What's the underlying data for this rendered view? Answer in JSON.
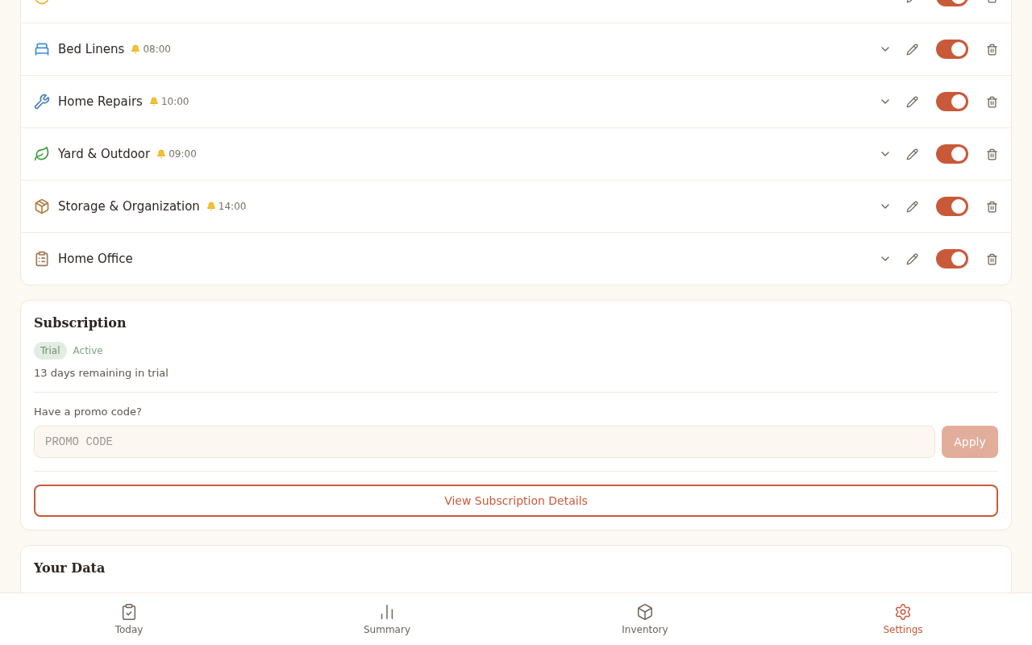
{
  "categories": [
    {
      "enabled": true
    },
    {
      "name": "Bed Linens",
      "reminder": "08:00",
      "enabled": true
    },
    {
      "name": "Home Repairs",
      "reminder": "10:00",
      "enabled": true
    },
    {
      "name": "Yard & Outdoor",
      "reminder": "09:00",
      "enabled": true
    },
    {
      "name": "Storage & Organization",
      "reminder": "14:00",
      "enabled": true
    },
    {
      "name": "Home Office",
      "enabled": true
    }
  ],
  "subscription": {
    "title": "Subscription",
    "plan": "Trial",
    "status": "Active",
    "remaining": "13 days remaining in trial",
    "promo_label": "Have a promo code?",
    "promo_placeholder": "PROMO CODE",
    "apply": "Apply",
    "apply_disabled": true,
    "details_button": "View Subscription Details"
  },
  "your_data": {
    "title": "Your Data"
  },
  "nav": [
    {
      "label": "Today",
      "selected": false
    },
    {
      "label": "Summary",
      "selected": false
    },
    {
      "label": "Inventory",
      "selected": false
    },
    {
      "label": "Settings",
      "selected": true
    }
  ]
}
